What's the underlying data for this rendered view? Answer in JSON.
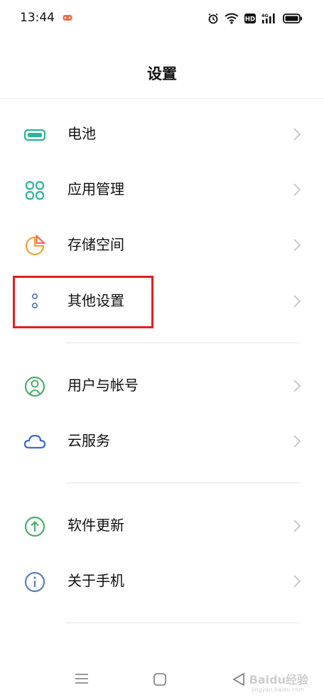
{
  "status_bar": {
    "time": "13:44",
    "icons": [
      "game-icon",
      "alarm-icon",
      "wifi-icon",
      "hd-icon",
      "signal-4g-icon",
      "battery-icon"
    ],
    "hd_label": "HD",
    "network_label": "4G"
  },
  "header": {
    "title": "设置"
  },
  "items": [
    {
      "label": "电池",
      "icon": "battery-icon",
      "color": "#2bb59a"
    },
    {
      "label": "应用管理",
      "icon": "apps-icon",
      "color": "#2bb59a"
    },
    {
      "label": "存储空间",
      "icon": "storage-icon",
      "color": "#f2a23a"
    },
    {
      "label": "其他设置",
      "icon": "more-settings-icon",
      "color": "#5a7fc0"
    },
    {
      "label": "用户与帐号",
      "icon": "user-icon",
      "color": "#4caf6b"
    },
    {
      "label": "云服务",
      "icon": "cloud-icon",
      "color": "#3a6bd8"
    },
    {
      "label": "软件更新",
      "icon": "update-icon",
      "color": "#4caf6b"
    },
    {
      "label": "关于手机",
      "icon": "info-icon",
      "color": "#5a7fc0"
    }
  ],
  "highlight_color": "#e02020",
  "nav_bar": {
    "buttons": [
      "menu-icon",
      "home-icon",
      "back-icon"
    ]
  },
  "watermark": {
    "text": "Baidu经验",
    "sub": "jingyan.baidu.com"
  }
}
